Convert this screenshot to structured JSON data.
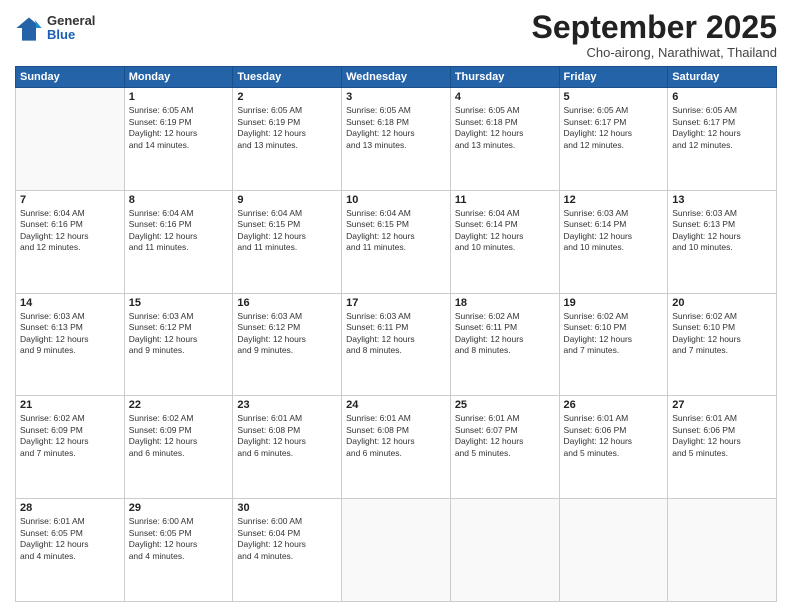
{
  "logo": {
    "general": "General",
    "blue": "Blue"
  },
  "header": {
    "month": "September 2025",
    "location": "Cho-airong, Narathiwat, Thailand"
  },
  "weekdays": [
    "Sunday",
    "Monday",
    "Tuesday",
    "Wednesday",
    "Thursday",
    "Friday",
    "Saturday"
  ],
  "weeks": [
    [
      {
        "day": null,
        "info": null
      },
      {
        "day": "1",
        "info": "Sunrise: 6:05 AM\nSunset: 6:19 PM\nDaylight: 12 hours\nand 14 minutes."
      },
      {
        "day": "2",
        "info": "Sunrise: 6:05 AM\nSunset: 6:19 PM\nDaylight: 12 hours\nand 13 minutes."
      },
      {
        "day": "3",
        "info": "Sunrise: 6:05 AM\nSunset: 6:18 PM\nDaylight: 12 hours\nand 13 minutes."
      },
      {
        "day": "4",
        "info": "Sunrise: 6:05 AM\nSunset: 6:18 PM\nDaylight: 12 hours\nand 13 minutes."
      },
      {
        "day": "5",
        "info": "Sunrise: 6:05 AM\nSunset: 6:17 PM\nDaylight: 12 hours\nand 12 minutes."
      },
      {
        "day": "6",
        "info": "Sunrise: 6:05 AM\nSunset: 6:17 PM\nDaylight: 12 hours\nand 12 minutes."
      }
    ],
    [
      {
        "day": "7",
        "info": "Sunrise: 6:04 AM\nSunset: 6:16 PM\nDaylight: 12 hours\nand 12 minutes."
      },
      {
        "day": "8",
        "info": "Sunrise: 6:04 AM\nSunset: 6:16 PM\nDaylight: 12 hours\nand 11 minutes."
      },
      {
        "day": "9",
        "info": "Sunrise: 6:04 AM\nSunset: 6:15 PM\nDaylight: 12 hours\nand 11 minutes."
      },
      {
        "day": "10",
        "info": "Sunrise: 6:04 AM\nSunset: 6:15 PM\nDaylight: 12 hours\nand 11 minutes."
      },
      {
        "day": "11",
        "info": "Sunrise: 6:04 AM\nSunset: 6:14 PM\nDaylight: 12 hours\nand 10 minutes."
      },
      {
        "day": "12",
        "info": "Sunrise: 6:03 AM\nSunset: 6:14 PM\nDaylight: 12 hours\nand 10 minutes."
      },
      {
        "day": "13",
        "info": "Sunrise: 6:03 AM\nSunset: 6:13 PM\nDaylight: 12 hours\nand 10 minutes."
      }
    ],
    [
      {
        "day": "14",
        "info": "Sunrise: 6:03 AM\nSunset: 6:13 PM\nDaylight: 12 hours\nand 9 minutes."
      },
      {
        "day": "15",
        "info": "Sunrise: 6:03 AM\nSunset: 6:12 PM\nDaylight: 12 hours\nand 9 minutes."
      },
      {
        "day": "16",
        "info": "Sunrise: 6:03 AM\nSunset: 6:12 PM\nDaylight: 12 hours\nand 9 minutes."
      },
      {
        "day": "17",
        "info": "Sunrise: 6:03 AM\nSunset: 6:11 PM\nDaylight: 12 hours\nand 8 minutes."
      },
      {
        "day": "18",
        "info": "Sunrise: 6:02 AM\nSunset: 6:11 PM\nDaylight: 12 hours\nand 8 minutes."
      },
      {
        "day": "19",
        "info": "Sunrise: 6:02 AM\nSunset: 6:10 PM\nDaylight: 12 hours\nand 7 minutes."
      },
      {
        "day": "20",
        "info": "Sunrise: 6:02 AM\nSunset: 6:10 PM\nDaylight: 12 hours\nand 7 minutes."
      }
    ],
    [
      {
        "day": "21",
        "info": "Sunrise: 6:02 AM\nSunset: 6:09 PM\nDaylight: 12 hours\nand 7 minutes."
      },
      {
        "day": "22",
        "info": "Sunrise: 6:02 AM\nSunset: 6:09 PM\nDaylight: 12 hours\nand 6 minutes."
      },
      {
        "day": "23",
        "info": "Sunrise: 6:01 AM\nSunset: 6:08 PM\nDaylight: 12 hours\nand 6 minutes."
      },
      {
        "day": "24",
        "info": "Sunrise: 6:01 AM\nSunset: 6:08 PM\nDaylight: 12 hours\nand 6 minutes."
      },
      {
        "day": "25",
        "info": "Sunrise: 6:01 AM\nSunset: 6:07 PM\nDaylight: 12 hours\nand 5 minutes."
      },
      {
        "day": "26",
        "info": "Sunrise: 6:01 AM\nSunset: 6:06 PM\nDaylight: 12 hours\nand 5 minutes."
      },
      {
        "day": "27",
        "info": "Sunrise: 6:01 AM\nSunset: 6:06 PM\nDaylight: 12 hours\nand 5 minutes."
      }
    ],
    [
      {
        "day": "28",
        "info": "Sunrise: 6:01 AM\nSunset: 6:05 PM\nDaylight: 12 hours\nand 4 minutes."
      },
      {
        "day": "29",
        "info": "Sunrise: 6:00 AM\nSunset: 6:05 PM\nDaylight: 12 hours\nand 4 minutes."
      },
      {
        "day": "30",
        "info": "Sunrise: 6:00 AM\nSunset: 6:04 PM\nDaylight: 12 hours\nand 4 minutes."
      },
      {
        "day": null,
        "info": null
      },
      {
        "day": null,
        "info": null
      },
      {
        "day": null,
        "info": null
      },
      {
        "day": null,
        "info": null
      }
    ]
  ]
}
